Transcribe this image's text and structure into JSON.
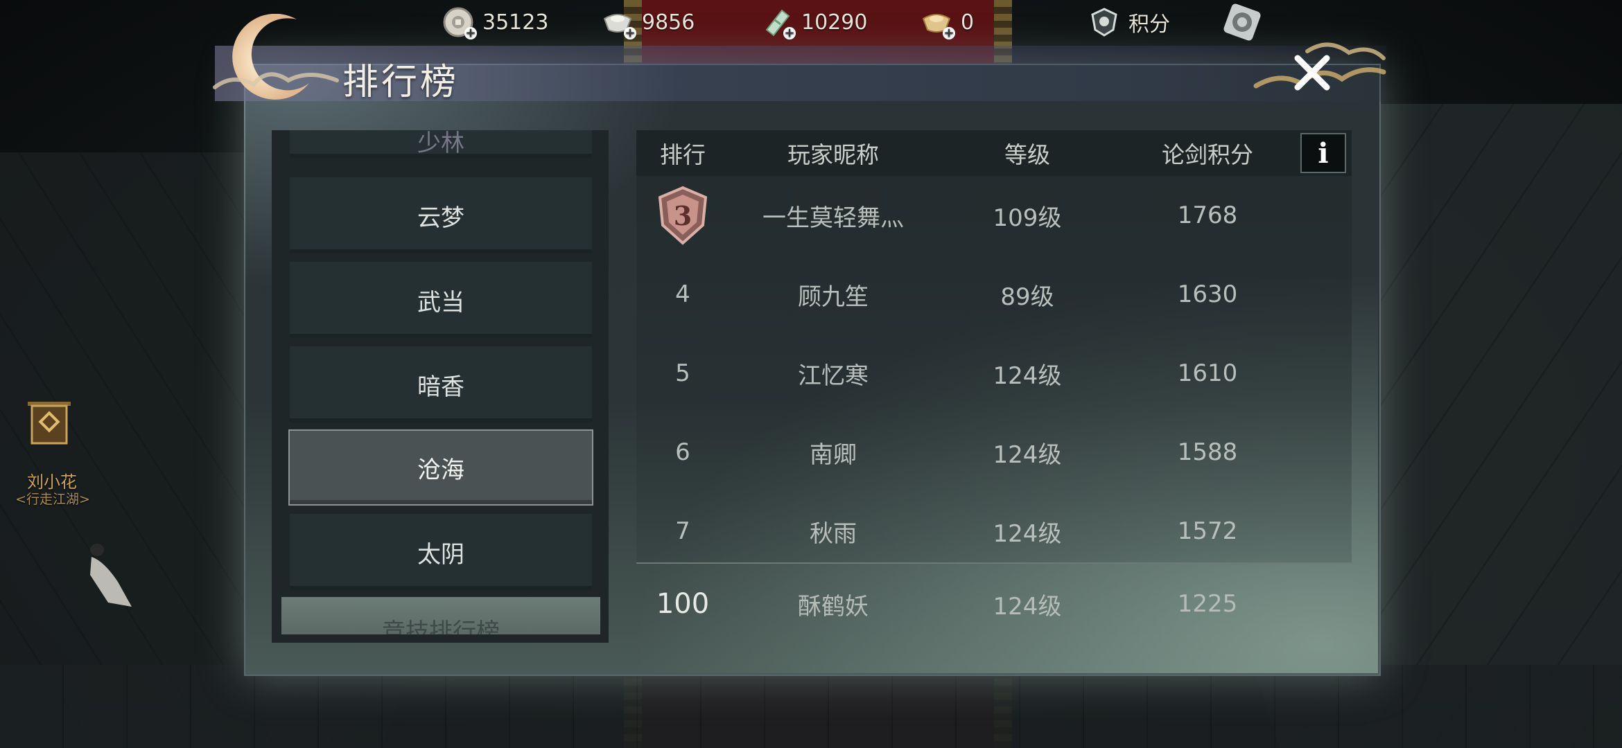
{
  "currencies": [
    {
      "icon": "silver-coin-icon",
      "value": "35123"
    },
    {
      "icon": "silver-ingot-icon",
      "value": "9856"
    },
    {
      "icon": "jade-ticket-icon",
      "value": "10290"
    },
    {
      "icon": "gold-ingot-icon",
      "value": "0"
    },
    {
      "icon": "points-shield-icon",
      "value": "积分"
    }
  ],
  "npc": {
    "name": "刘小花",
    "title": "<行走江湖>"
  },
  "window": {
    "title": "排行榜"
  },
  "categories": {
    "partial_top": "少林",
    "items": [
      {
        "label": "云梦",
        "active": false
      },
      {
        "label": "武当",
        "active": false
      },
      {
        "label": "暗香",
        "active": false
      },
      {
        "label": "沧海",
        "active": true
      },
      {
        "label": "太阴",
        "active": false
      }
    ],
    "bottom_button": "竞技排行榜"
  },
  "table": {
    "headers": {
      "rank": "排行",
      "name": "玩家昵称",
      "level": "等级",
      "score": "论剑积分"
    },
    "info_label": "i",
    "rows": [
      {
        "rank": "3",
        "medal": true,
        "name": "一生莫轻舞灬",
        "level": "109级",
        "score": "1768"
      },
      {
        "rank": "4",
        "medal": false,
        "name": "顾九笙",
        "level": "89级",
        "score": "1630"
      },
      {
        "rank": "5",
        "medal": false,
        "name": "江忆寒",
        "level": "124级",
        "score": "1610"
      },
      {
        "rank": "6",
        "medal": false,
        "name": "南卿",
        "level": "124级",
        "score": "1588"
      },
      {
        "rank": "7",
        "medal": false,
        "name": "秋雨",
        "level": "124级",
        "score": "1572"
      }
    ],
    "self": {
      "rank": "100",
      "name": "酥鹤妖",
      "level": "124级",
      "score": "1225"
    }
  },
  "colors": {
    "accent_gold": "#c9a45a",
    "panel_bg": "#2a3336",
    "medal": "#b88680"
  }
}
